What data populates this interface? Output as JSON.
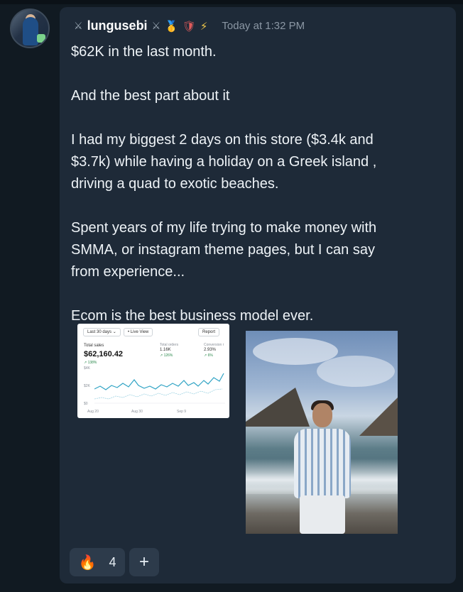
{
  "post": {
    "username": "lungusebi",
    "flair_left": "⚔",
    "flair_right": "⚔",
    "timestamp": "Today at 1:32 PM",
    "lines": [
      "$62K in the last month.",
      "",
      "And the best part about it",
      "",
      "I had my biggest 2 days on this store ($3.4k and",
      "$3.7k) while having a holiday on a Greek island ,",
      "driving a quad to exotic beaches.",
      "",
      "Spent years of my life trying to make money with",
      "SMMA, or instagram theme pages, but I can say",
      "from experience...",
      "",
      "Ecom is the best business model ever."
    ]
  },
  "icons": {
    "medal": "🥇",
    "shield": "🛡",
    "bolt": "⚡",
    "fire": "🔥",
    "add": "+"
  },
  "chart_image": {
    "range_chip": "Last 30 days ⌄",
    "live_chip": "• Live View",
    "report_chip": "Report",
    "total_sales_label": "Total sales",
    "total_sales_value": "$62,160.42",
    "total_sales_change": "↗ 138%",
    "orders_label": "Total orders",
    "orders_value": "1.16K",
    "orders_change": "↗ 126%",
    "conversion_label": "Conversion r",
    "conversion_value": "2.93%",
    "conversion_change": "↗ 6%",
    "y_labels": [
      "$4K",
      "$2K",
      "$0"
    ],
    "x_labels": [
      "Aug 20",
      "Aug 30",
      "Sep 9"
    ]
  },
  "reactions": {
    "fire_count": "4"
  },
  "colors": {
    "background": "#111a22",
    "card": "#1e2a38",
    "reaction": "#2d3b4b",
    "timestamp": "#8b97a4",
    "chart_line": "#2fa3c4"
  }
}
